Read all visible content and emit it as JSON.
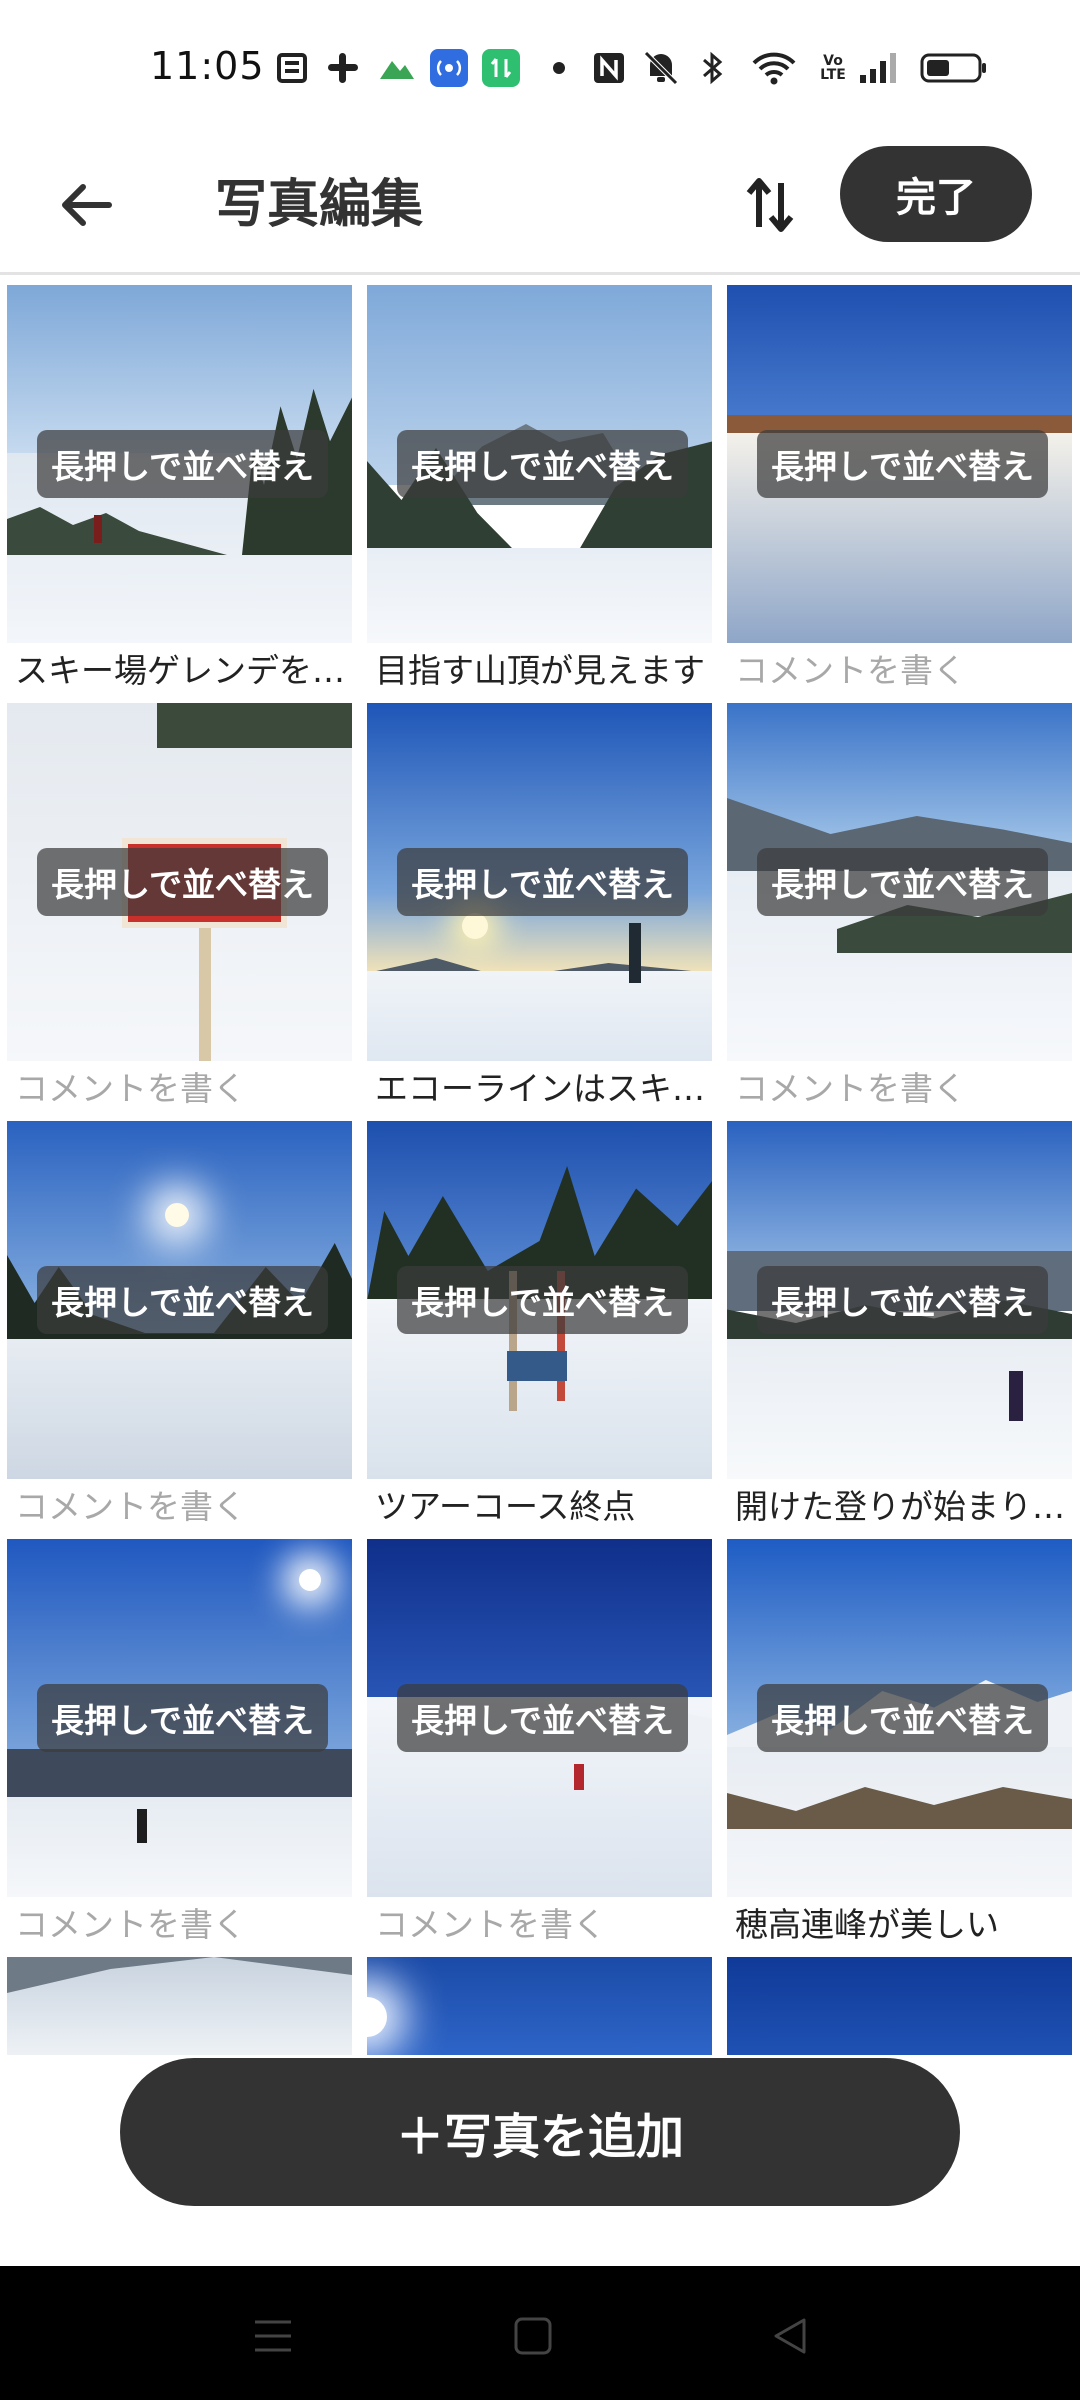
{
  "status_bar": {
    "time": "11:05",
    "icons": [
      "newspaper-icon",
      "slack-icon",
      "mountain-icon",
      "broadcast-icon",
      "data-transfer-icon",
      "dot-icon",
      "nfc-icon",
      "mute-icon",
      "bluetooth-icon",
      "wifi-icon",
      "volte-icon",
      "signal-icon",
      "battery-icon"
    ],
    "volte_label": "Vo\nLTE",
    "nfc_label": "N"
  },
  "header": {
    "title": "写真編集",
    "done_label": "完了"
  },
  "photo_overlay_label": "長押しで並べ替え",
  "photos": [
    {
      "comment": "スキー場ゲレンデを…",
      "placeholder": false
    },
    {
      "comment": "目指す山頂が見えます",
      "placeholder": false
    },
    {
      "comment": "コメントを書く",
      "placeholder": true
    },
    {
      "comment": "コメントを書く",
      "placeholder": true
    },
    {
      "comment": "エコーラインはスキ…",
      "placeholder": false
    },
    {
      "comment": "コメントを書く",
      "placeholder": true
    },
    {
      "comment": "コメントを書く",
      "placeholder": true
    },
    {
      "comment": "ツアーコース終点",
      "placeholder": false
    },
    {
      "comment": "開けた登りが始まり…",
      "placeholder": false
    },
    {
      "comment": "コメントを書く",
      "placeholder": true
    },
    {
      "comment": "コメントを書く",
      "placeholder": true
    },
    {
      "comment": "穂高連峰が美しい",
      "placeholder": false
    },
    {
      "comment": "",
      "placeholder": false
    },
    {
      "comment": "",
      "placeholder": false
    },
    {
      "comment": "",
      "placeholder": false
    }
  ],
  "add_photo_label": "＋写真を追加",
  "colors": {
    "button_bg": "#333333",
    "placeholder_text": "#a8a8a8",
    "sky_blue": "#2f6fd0",
    "snow": "#eef2f7"
  }
}
